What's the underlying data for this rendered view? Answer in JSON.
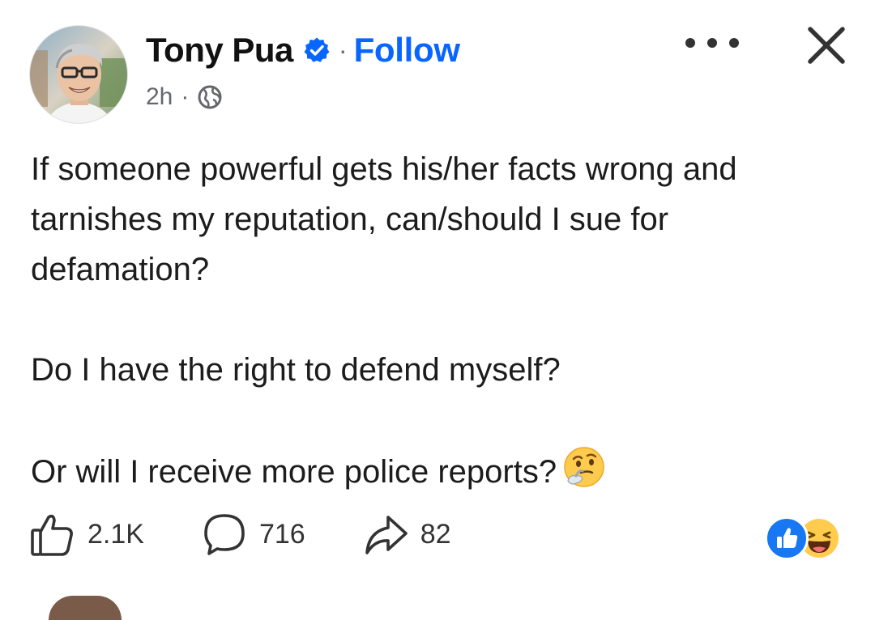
{
  "post": {
    "author": "Tony Pua",
    "separator": "·",
    "follow_label": "Follow",
    "time": "2h",
    "meta_separator": "·",
    "icons": {
      "verified": "verified-badge-icon",
      "audience": "globe-icon",
      "more": "more-options-icon",
      "close": "close-icon"
    },
    "paragraphs": [
      "If someone powerful gets his/her facts wrong and tarnishes my reputation, can/should I sue for defamation?",
      "Do I have the right to defend myself?",
      "Or will I receive more police reports?"
    ],
    "trailing_emoji": "thinking-face-emoji"
  },
  "actions": {
    "likes": "2.1K",
    "comments": "716",
    "shares": "82"
  },
  "reactions": [
    "like-reaction",
    "haha-reaction"
  ],
  "colors": {
    "accent": "#0866ff",
    "like_blue": "#1877f2",
    "text": "#1c1c1c",
    "muted": "#65676b"
  }
}
